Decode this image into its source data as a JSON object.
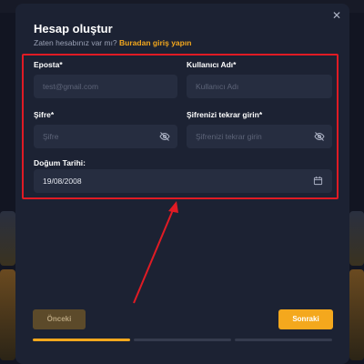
{
  "modal": {
    "title": "Hesap oluştur",
    "subtitle": "Zaten hesabınız var mı?",
    "login_link": "Buradan giriş yapın",
    "close_icon": "close-icon"
  },
  "form": {
    "email": {
      "label": "Eposta*",
      "placeholder": "test@gmail.com"
    },
    "username": {
      "label": "Kullanıcı Adı*",
      "placeholder": "Kullanıcı Adı"
    },
    "password": {
      "label": "Şifre*",
      "placeholder": "Şifre",
      "icon": "eye-off-icon"
    },
    "password_confirm": {
      "label": "Şifrenizi tekrar girin*",
      "placeholder": "Şifrenizi tekrar girin",
      "icon": "eye-off-icon"
    },
    "birthdate": {
      "label": "Doğum Tarihi:",
      "value": "19/08/2008",
      "icon": "calendar-icon"
    }
  },
  "buttons": {
    "prev": "Önceki",
    "next": "Sonraki"
  },
  "steps": {
    "total": 3,
    "current": 1
  },
  "colors": {
    "accent": "#f4a81d",
    "highlight": "#e01b24",
    "modal_bg": "#1c2233",
    "field_bg": "#262d40"
  }
}
